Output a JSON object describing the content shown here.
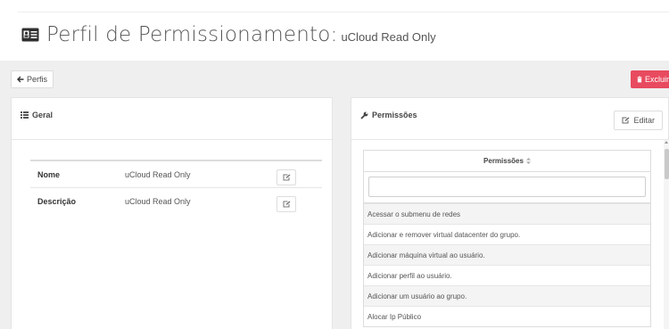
{
  "header": {
    "title_icon": "id-card-icon",
    "title": "Perfil de Permissionamento:",
    "subtitle": "uCloud Read Only"
  },
  "toolbar": {
    "back_label": "Perfis",
    "back_icon": "arrow-left-icon",
    "delete_label": "Excluir",
    "delete_icon": "trash-icon",
    "delete_color": "#e84a5f"
  },
  "general": {
    "title": "Geral",
    "icon": "list-icon",
    "rows": [
      {
        "label": "Nome",
        "value": "uCloud Read Only"
      },
      {
        "label": "Descrição",
        "value": "uCloud Read Only"
      }
    ]
  },
  "permissions": {
    "title": "Permissões",
    "icon": "wrench-icon",
    "edit_label": "Editar",
    "edit_icon": "edit-icon",
    "column_header": "Permissões",
    "sort_icon": "sort-icon",
    "filter_value": "",
    "rows": [
      "Acessar o submenu de redes",
      "Adicionar e remover virtual datacenter do grupo.",
      "Adicionar máquina virtual ao usuário.",
      "Adicionar perfil ao usuário.",
      "Adicionar um usuário ao grupo.",
      "Alocar Ip Público"
    ]
  }
}
